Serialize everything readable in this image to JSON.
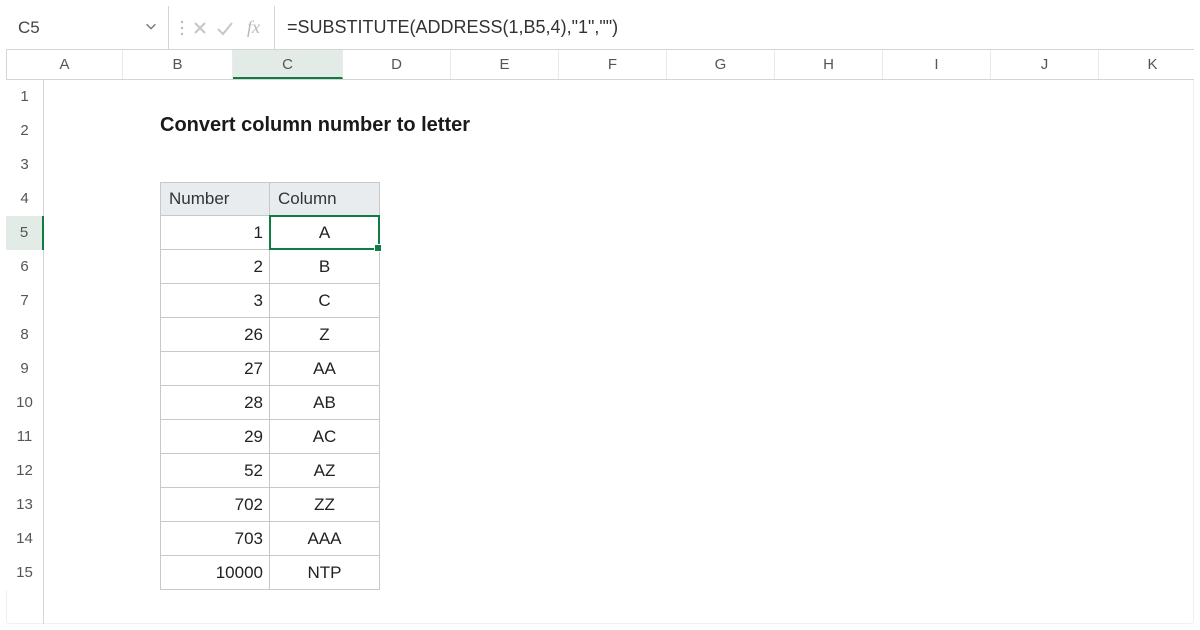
{
  "namebox": {
    "ref": "C5"
  },
  "formula_bar": {
    "formula": "=SUBSTITUTE(ADDRESS(1,B5,4),\"1\",\"\")"
  },
  "columns": [
    "A",
    "B",
    "C",
    "D",
    "E",
    "F",
    "G",
    "H",
    "I",
    "J",
    "K"
  ],
  "rows": [
    "1",
    "2",
    "3",
    "4",
    "5",
    "6",
    "7",
    "8",
    "9",
    "10",
    "11",
    "12",
    "13",
    "14",
    "15"
  ],
  "selected_col_index": 2,
  "selected_row_index": 4,
  "title": "Convert column number to letter",
  "table": {
    "headers": {
      "number": "Number",
      "column": "Column"
    },
    "rows": [
      {
        "number": "1",
        "column": "A"
      },
      {
        "number": "2",
        "column": "B"
      },
      {
        "number": "3",
        "column": "C"
      },
      {
        "number": "26",
        "column": "Z"
      },
      {
        "number": "27",
        "column": "AA"
      },
      {
        "number": "28",
        "column": "AB"
      },
      {
        "number": "29",
        "column": "AC"
      },
      {
        "number": "52",
        "column": "AZ"
      },
      {
        "number": "702",
        "column": "ZZ"
      },
      {
        "number": "703",
        "column": "AAA"
      },
      {
        "number": "10000",
        "column": "NTP"
      }
    ]
  },
  "colors": {
    "accent": "#107c41",
    "header_fill": "#e8ecef"
  }
}
